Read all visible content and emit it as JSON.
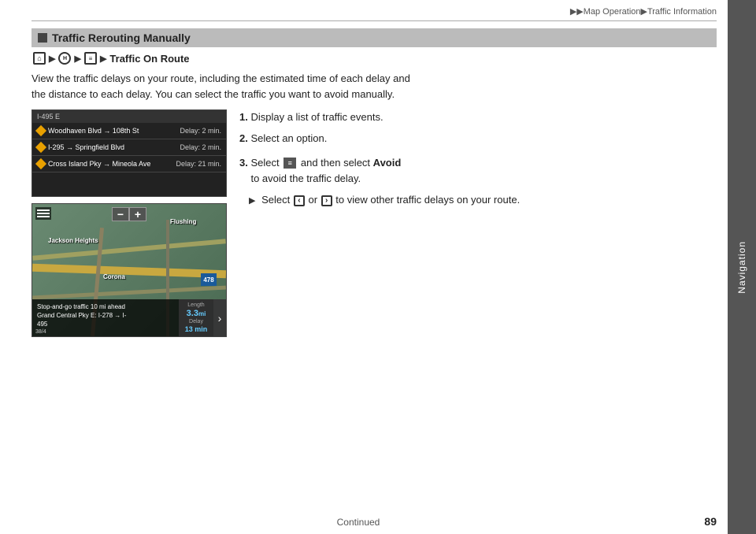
{
  "header": {
    "breadcrumb": "▶▶Map Operation▶Traffic Information"
  },
  "sidebar": {
    "label": "Navigation"
  },
  "section": {
    "title": "Traffic Rerouting Manually"
  },
  "nav_line": {
    "icons": [
      "home",
      "arrow",
      "circle-h",
      "arrow",
      "map",
      "arrow"
    ],
    "label": "Traffic On Route"
  },
  "description": {
    "line1": "View the traffic delays on your route, including the estimated time of each delay and",
    "line2": "the distance to each delay. You can select the traffic you want to avoid manually."
  },
  "traffic_list": {
    "header": "I-495 E",
    "items": [
      {
        "route": "Woodhaven Blvd → 108th St",
        "delay": "Delay: 2 min."
      },
      {
        "route": "I-295 → Springfield Blvd",
        "delay": "Delay: 2 min."
      },
      {
        "route": "Cross Island Pky → Mineola Ave",
        "delay": "Delay: 21 min."
      }
    ]
  },
  "map": {
    "area_labels": [
      "Jackson Heights",
      "Corona",
      "Flushing",
      "478"
    ],
    "info_text": "Stop-and-go traffic 10 mi ahead\nGrand Central Pky E: I-278 → I-\n495",
    "stats": {
      "length_label": "Length",
      "length_value": "3.3",
      "length_unit": "mi",
      "delay_label": "Delay",
      "delay_value": "13 min"
    },
    "coord": "38/4"
  },
  "steps": {
    "step1_num": "1.",
    "step1_text": "Display a list of traffic events.",
    "step2_num": "2.",
    "step2_text": "Select an option.",
    "step3_num": "3.",
    "step3_pre": "Select",
    "step3_mid": "and then select",
    "step3_bold": "Avoid",
    "step3_post": "to avoid the traffic delay.",
    "bullet_pre": "Select",
    "bullet_mid": "or",
    "bullet_post": "to view other traffic delays on your route."
  },
  "footer": {
    "continued": "Continued"
  },
  "page": {
    "number": "89"
  }
}
